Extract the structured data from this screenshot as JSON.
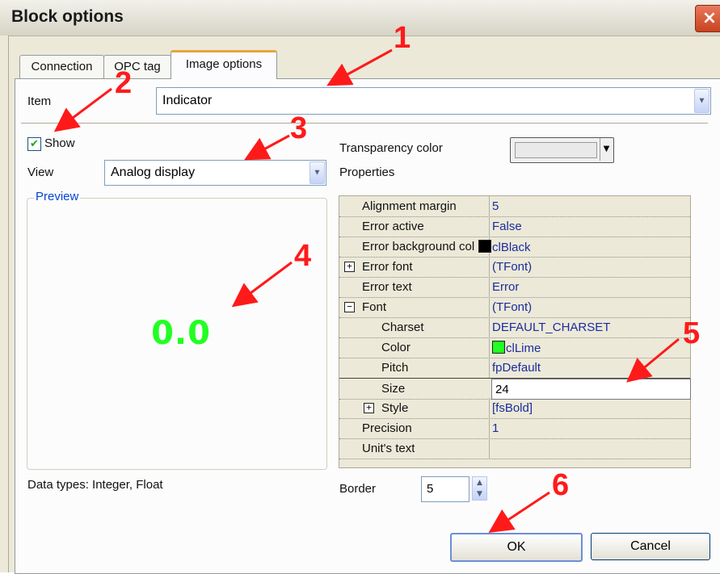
{
  "window": {
    "title": "Block options",
    "close_icon": "×"
  },
  "tabs": [
    {
      "label": "Connection",
      "active": false
    },
    {
      "label": "OPC tag",
      "active": false
    },
    {
      "label": "Image options",
      "active": true
    }
  ],
  "item": {
    "label": "Item",
    "value": "Indicator"
  },
  "show": {
    "label": "Show",
    "checked": true
  },
  "view": {
    "label": "View",
    "value": "Analog display"
  },
  "preview": {
    "legend": "Preview",
    "value": "0.0",
    "value_color": "#22ff22"
  },
  "transparency": {
    "label": "Transparency color"
  },
  "properties": {
    "label": "Properties",
    "rows": [
      {
        "name": "Alignment margin",
        "value": "5"
      },
      {
        "name": "Error active",
        "value": "False"
      },
      {
        "name": "Error background col",
        "value": "clBlack",
        "swatch": "#000000"
      },
      {
        "name": "Error font",
        "value": "(TFont)",
        "expand": "+"
      },
      {
        "name": "Error text",
        "value": "Error"
      },
      {
        "name": "Font",
        "value": "(TFont)",
        "expand": "−"
      },
      {
        "name": "Charset",
        "value": "DEFAULT_CHARSET"
      },
      {
        "name": "Color",
        "value": "clLime",
        "swatch": "#22ff22"
      },
      {
        "name": "Pitch",
        "value": "fpDefault"
      },
      {
        "name": "Size",
        "value": "24"
      },
      {
        "name": "Style",
        "value": "[fsBold]",
        "expand": "+"
      },
      {
        "name": "Precision",
        "value": "1"
      },
      {
        "name": "Unit's text",
        "value": ""
      }
    ]
  },
  "data_types": "Data types: Integer, Float",
  "border": {
    "label": "Border",
    "value": "5"
  },
  "buttons": {
    "ok": "OK",
    "cancel": "Cancel"
  },
  "annotations": [
    "1",
    "2",
    "3",
    "4",
    "5",
    "6"
  ],
  "colors": {
    "annotation": "#ff1a1a",
    "value_text": "#1a2c9f"
  }
}
